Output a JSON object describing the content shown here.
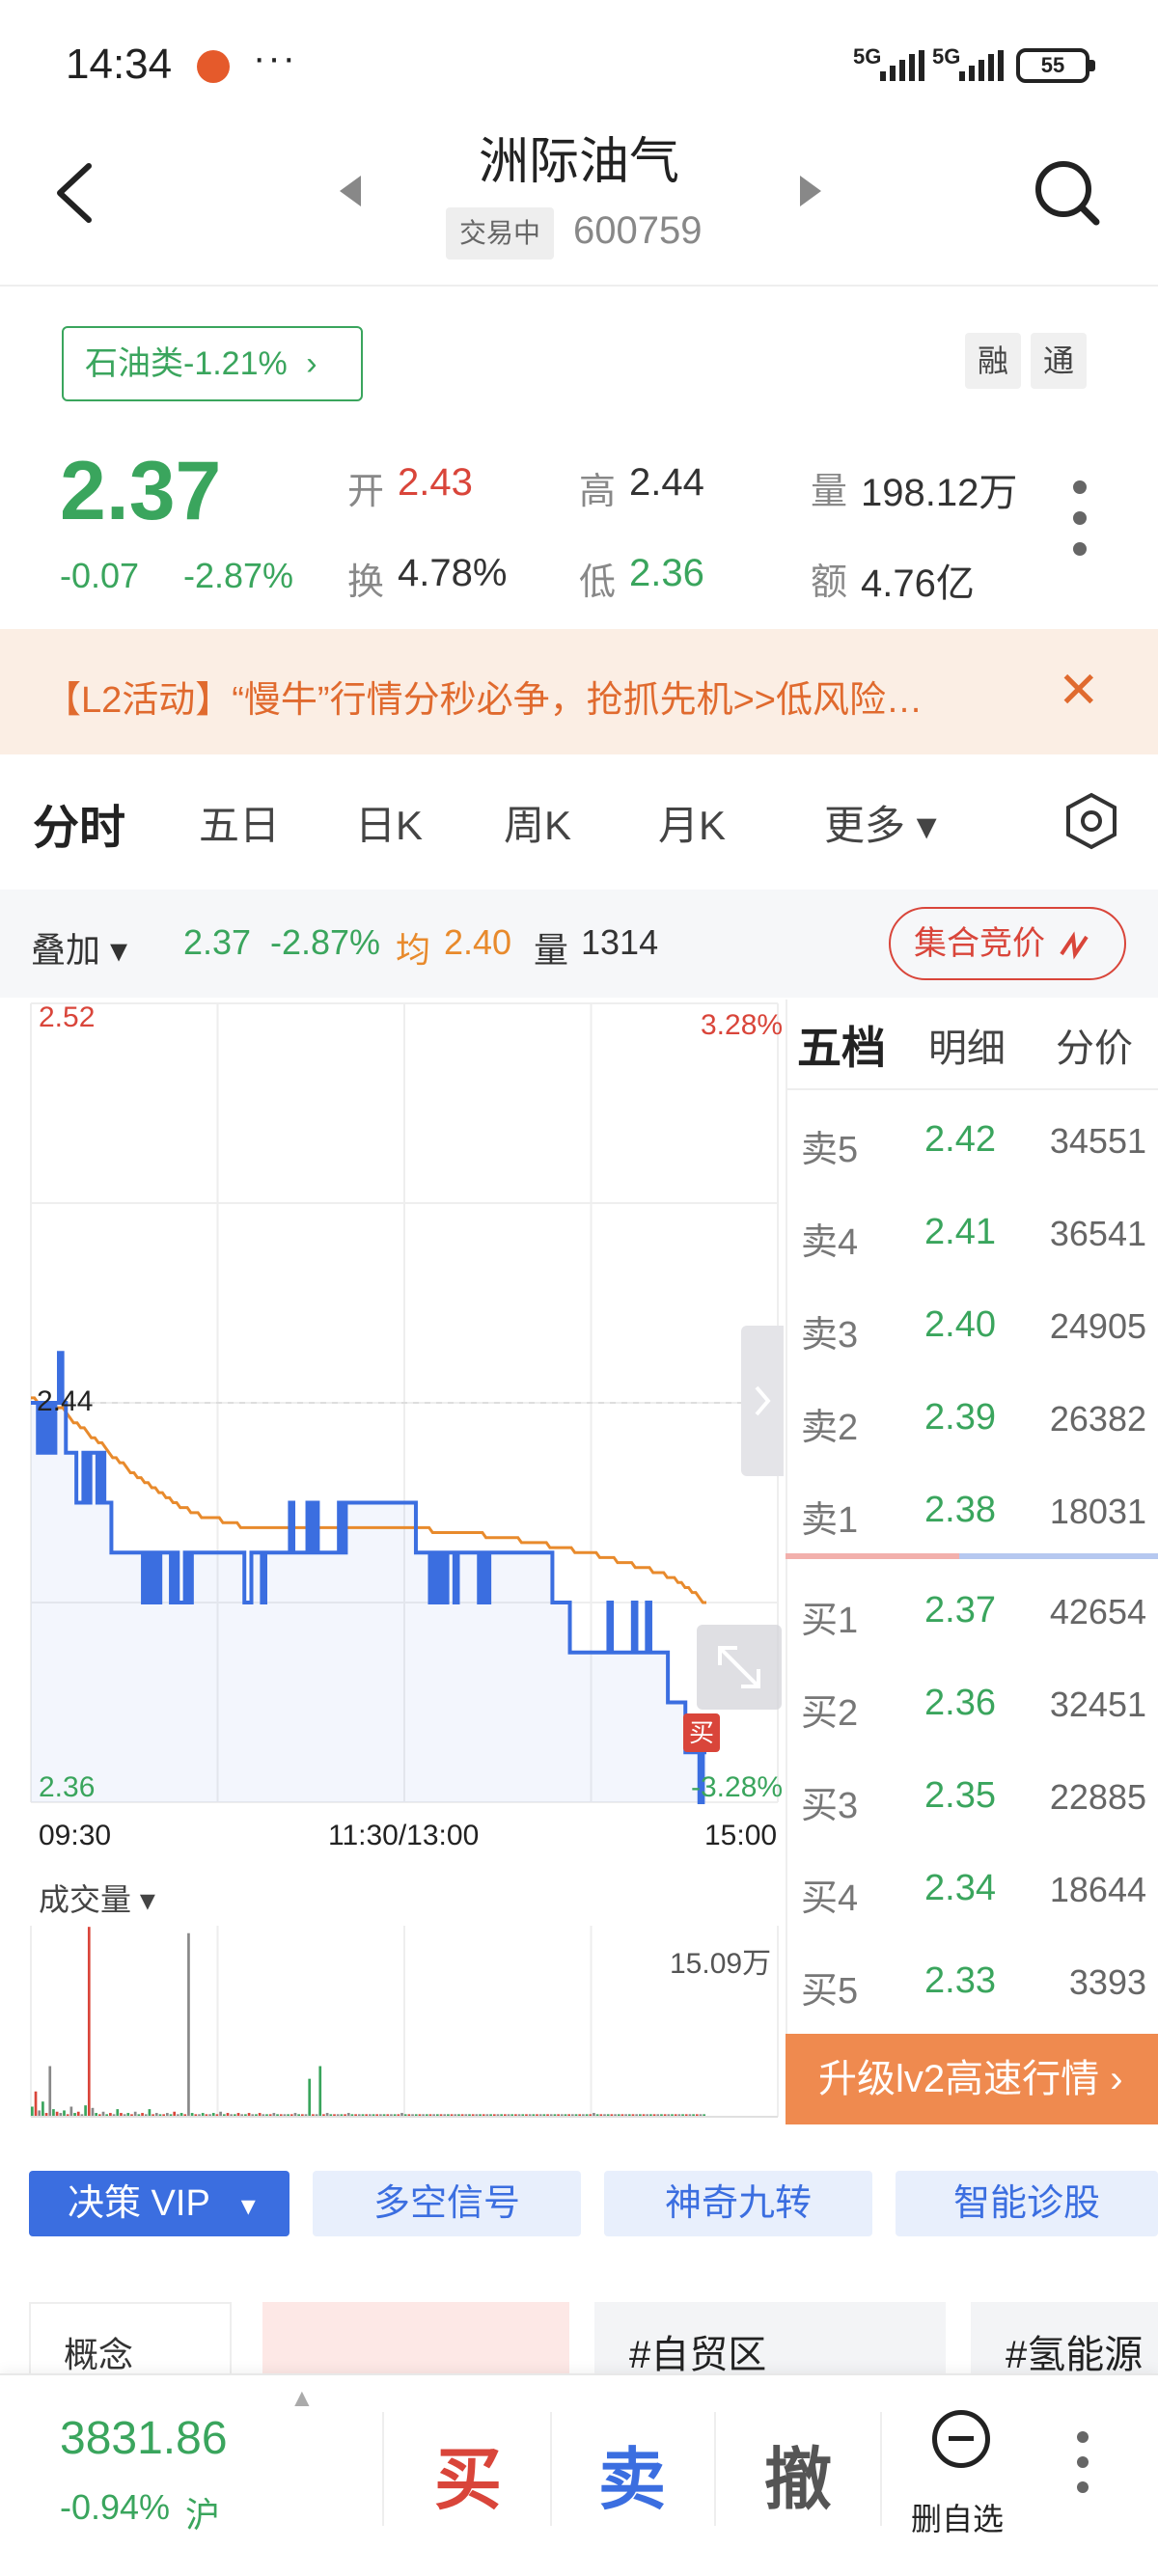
{
  "status_bar": {
    "time": "14:34",
    "dots": "···",
    "signal_a": "5G",
    "signal_b": "5G",
    "battery": "55"
  },
  "header": {
    "stock_name": "洲际油气",
    "trade_status": "交易中",
    "stock_code": "600759"
  },
  "sector": {
    "label": "石油类-1.21%",
    "chevron": "›"
  },
  "tags": {
    "margin": "融",
    "connect": "通"
  },
  "quote": {
    "price": "2.37",
    "change_abs": "-0.07",
    "change_pct": "-2.87%",
    "open_label": "开",
    "open": "2.43",
    "high_label": "高",
    "high": "2.44",
    "volume_label": "量",
    "volume": "198.12万",
    "turnover_label": "换",
    "turnover": "4.78%",
    "low_label": "低",
    "low": "2.36",
    "amount_label": "额",
    "amount": "4.76亿"
  },
  "banner": {
    "text": "【L2活动】“慢牛”行情分秒必争，抢抓先机>>低风险…",
    "close": "✕"
  },
  "tabs": [
    {
      "label": "分时"
    },
    {
      "label": "五日"
    },
    {
      "label": "日K"
    },
    {
      "label": "周K"
    },
    {
      "label": "月K"
    },
    {
      "label": "更多 ▾"
    }
  ],
  "overlay": {
    "toggle": "叠加 ▾",
    "price": "2.37",
    "pct": "-2.87%",
    "avg_label": "均",
    "avg": "2.40",
    "vol_label": "量",
    "vol": "1314",
    "auction": "集合竞价"
  },
  "chart_axes": {
    "high": "2.52",
    "high_pct": "3.28%",
    "prev_close": "2.44",
    "low": "2.36",
    "low_pct": "-3.28%",
    "t_open": "09:30",
    "t_mid": "11:30/13:00",
    "t_close": "15:00",
    "volume_label": "成交量 ▾",
    "volume_max": "15.09万",
    "buy_marker": "买"
  },
  "chart_data": {
    "type": "line",
    "ylim": [
      2.36,
      2.52
    ],
    "prev_close": 2.44,
    "x_labels": [
      "09:30",
      "11:30/13:00",
      "15:00"
    ],
    "series": [
      {
        "color": "#3b6ee0",
        "values": [
          2.44,
          2.44,
          2.43,
          2.44,
          2.43,
          2.44,
          2.43,
          2.44,
          2.45,
          2.44,
          2.43,
          2.43,
          2.43,
          2.42,
          2.42,
          2.43,
          2.42,
          2.43,
          2.43,
          2.42,
          2.43,
          2.42,
          2.42,
          2.41,
          2.41,
          2.41,
          2.41,
          2.41,
          2.41,
          2.41,
          2.41,
          2.41,
          2.4,
          2.41,
          2.4,
          2.41,
          2.4,
          2.41,
          2.41,
          2.41,
          2.4,
          2.41,
          2.4,
          2.4,
          2.41,
          2.4,
          2.41,
          2.41,
          2.41,
          2.41,
          2.41,
          2.41,
          2.41,
          2.41,
          2.41,
          2.41,
          2.41,
          2.41,
          2.41,
          2.41,
          2.41,
          2.4,
          2.4,
          2.41,
          2.41,
          2.41,
          2.4,
          2.41,
          2.41,
          2.41,
          2.41,
          2.41,
          2.41,
          2.41,
          2.42,
          2.41,
          2.41,
          2.41,
          2.41,
          2.42,
          2.41,
          2.42,
          2.41,
          2.41,
          2.41,
          2.41,
          2.41,
          2.41,
          2.42,
          2.41,
          2.42,
          2.42,
          2.42,
          2.42,
          2.42,
          2.42,
          2.42,
          2.42,
          2.42,
          2.42,
          2.42,
          2.42,
          2.42,
          2.42,
          2.42,
          2.42,
          2.42,
          2.42,
          2.42,
          2.42,
          2.41,
          2.41,
          2.41,
          2.41,
          2.4,
          2.41,
          2.4,
          2.41,
          2.4,
          2.41,
          2.41,
          2.4,
          2.41,
          2.41,
          2.41,
          2.41,
          2.41,
          2.41,
          2.4,
          2.41,
          2.4,
          2.41,
          2.41,
          2.41,
          2.41,
          2.41,
          2.41,
          2.41,
          2.41,
          2.41,
          2.41,
          2.41,
          2.41,
          2.41,
          2.41,
          2.41,
          2.41,
          2.41,
          2.41,
          2.4,
          2.4,
          2.4,
          2.4,
          2.4,
          2.39,
          2.39,
          2.39,
          2.39,
          2.39,
          2.39,
          2.39,
          2.39,
          2.39,
          2.39,
          2.39,
          2.4,
          2.39,
          2.39,
          2.39,
          2.39,
          2.39,
          2.39,
          2.4,
          2.39,
          2.39,
          2.39,
          2.4,
          2.39,
          2.39,
          2.39,
          2.39,
          2.39,
          2.38,
          2.38,
          2.38,
          2.38,
          2.38,
          2.37,
          2.37,
          2.37,
          2.37,
          2.36,
          2.37,
          2.37
        ]
      },
      {
        "color": "#e88a2c",
        "values": [
          2.441,
          2.441,
          2.44,
          2.44,
          2.44,
          2.439,
          2.439,
          2.439,
          2.439,
          2.439,
          2.438,
          2.437,
          2.436,
          2.436,
          2.435,
          2.435,
          2.434,
          2.433,
          2.433,
          2.432,
          2.432,
          2.431,
          2.43,
          2.429,
          2.429,
          2.428,
          2.428,
          2.427,
          2.426,
          2.426,
          2.425,
          2.425,
          2.424,
          2.424,
          2.423,
          2.423,
          2.422,
          2.422,
          2.421,
          2.421,
          2.42,
          2.42,
          2.419,
          2.419,
          2.419,
          2.418,
          2.418,
          2.418,
          2.417,
          2.417,
          2.417,
          2.417,
          2.417,
          2.417,
          2.416,
          2.416,
          2.416,
          2.416,
          2.416,
          2.415,
          2.415,
          2.415,
          2.415,
          2.415,
          2.415,
          2.415,
          2.415,
          2.415,
          2.415,
          2.415,
          2.415,
          2.415,
          2.415,
          2.415,
          2.415,
          2.415,
          2.415,
          2.415,
          2.415,
          2.415,
          2.415,
          2.415,
          2.415,
          2.415,
          2.415,
          2.415,
          2.415,
          2.415,
          2.415,
          2.415,
          2.415,
          2.415,
          2.415,
          2.415,
          2.415,
          2.415,
          2.415,
          2.415,
          2.415,
          2.415,
          2.415,
          2.415,
          2.415,
          2.415,
          2.415,
          2.415,
          2.415,
          2.415,
          2.415,
          2.415,
          2.415,
          2.415,
          2.415,
          2.414,
          2.414,
          2.414,
          2.414,
          2.414,
          2.414,
          2.414,
          2.414,
          2.414,
          2.414,
          2.414,
          2.414,
          2.414,
          2.414,
          2.414,
          2.413,
          2.413,
          2.413,
          2.413,
          2.413,
          2.413,
          2.413,
          2.413,
          2.413,
          2.413,
          2.412,
          2.412,
          2.412,
          2.412,
          2.412,
          2.412,
          2.412,
          2.412,
          2.411,
          2.411,
          2.411,
          2.411,
          2.411,
          2.411,
          2.411,
          2.41,
          2.41,
          2.41,
          2.41,
          2.41,
          2.41,
          2.41,
          2.409,
          2.409,
          2.409,
          2.409,
          2.409,
          2.408,
          2.408,
          2.408,
          2.408,
          2.408,
          2.407,
          2.407,
          2.407,
          2.407,
          2.407,
          2.406,
          2.406,
          2.406,
          2.406,
          2.405,
          2.405,
          2.405,
          2.404,
          2.404,
          2.403,
          2.403,
          2.402,
          2.402,
          2.401,
          2.4,
          2.4
        ]
      }
    ],
    "volume": {
      "ymax": 150900,
      "values": [
        8000,
        20000,
        5000,
        12000,
        3000,
        40000,
        6000,
        4000,
        3000,
        5000,
        2000,
        8000,
        3000,
        4000,
        2000,
        9000,
        150000,
        7000,
        3000,
        2000,
        4000,
        2000,
        3000,
        2000,
        6000,
        3000,
        2000,
        3000,
        2000,
        4000,
        2000,
        3000,
        2000,
        6000,
        2000,
        3000,
        2000,
        2000,
        3000,
        2000,
        4000,
        2000,
        3000,
        2000,
        145000,
        3000,
        2000,
        2000,
        3000,
        2000,
        2000,
        3000,
        2000,
        4000,
        2000,
        3000,
        2000,
        2000,
        3000,
        2000,
        2000,
        3000,
        2000,
        2000,
        3000,
        2000,
        2000,
        2000,
        3000,
        2000,
        2000,
        2000,
        2000,
        2000,
        3000,
        2000,
        2000,
        2000,
        30000,
        2000,
        2000,
        40000,
        2000,
        3000,
        2000,
        2000,
        2000,
        2000,
        2000,
        3000,
        2000,
        2000,
        2000,
        2000,
        2000,
        2000,
        2000,
        2000,
        2000,
        2000,
        2000,
        2000,
        2000,
        2000,
        3000,
        2000,
        2000,
        2000,
        2000,
        2000,
        2000,
        2000,
        2000,
        2000,
        2000,
        2000,
        2000,
        2000,
        2000,
        2000,
        2000,
        2000,
        2000,
        2000,
        2000,
        2000,
        2000,
        2000,
        2000,
        2000,
        2000,
        2000,
        2000,
        2000,
        2000,
        2000,
        2000,
        2000,
        2000,
        2000,
        2000,
        2000,
        2000,
        2000,
        2000,
        2000,
        2000,
        2000,
        2000,
        2000,
        2000,
        2000,
        2000,
        2000,
        2000,
        2000,
        2000,
        2000,
        3000,
        2000,
        2000,
        2000,
        2000,
        2000,
        2000,
        2000,
        2000,
        2000,
        2000,
        2000,
        2000,
        2000,
        2000,
        2000,
        2000,
        2000,
        2000,
        2000,
        2000,
        2000,
        2000,
        2000,
        2000,
        2000,
        2000,
        2000,
        2000,
        2000,
        2000,
        2000
      ]
    }
  },
  "order_book": {
    "tabs": [
      {
        "label": "五档"
      },
      {
        "label": "明细"
      },
      {
        "label": "分价"
      }
    ],
    "asks": [
      {
        "label": "卖5",
        "price": "2.42",
        "vol": "34551"
      },
      {
        "label": "卖4",
        "price": "2.41",
        "vol": "36541"
      },
      {
        "label": "卖3",
        "price": "2.40",
        "vol": "24905"
      },
      {
        "label": "卖2",
        "price": "2.39",
        "vol": "26382"
      },
      {
        "label": "卖1",
        "price": "2.38",
        "vol": "18031"
      }
    ],
    "bids": [
      {
        "label": "买1",
        "price": "2.37",
        "vol": "42654"
      },
      {
        "label": "买2",
        "price": "2.36",
        "vol": "32451"
      },
      {
        "label": "买3",
        "price": "2.35",
        "vol": "22885"
      },
      {
        "label": "买4",
        "price": "2.34",
        "vol": "18644"
      },
      {
        "label": "买5",
        "price": "2.33",
        "vol": "3393"
      }
    ],
    "upgrade": "升级lv2高速行情 ›"
  },
  "indicators": {
    "vip": "决策 VIP",
    "vip_arrow": "▾",
    "signal": "多空信号",
    "nine": "神奇九转",
    "diagnose": "智能诊股"
  },
  "concepts": {
    "label": "概念",
    "tag1": "#自贸区",
    "tag2": "#氢能源"
  },
  "bottom": {
    "index_value": "3831.86",
    "index_change": "-0.94%",
    "index_market": "沪",
    "buy": "买",
    "sell": "卖",
    "cancel": "撤",
    "remove_fav": "删自选"
  },
  "colors": {
    "up": "#d9453a",
    "down": "#3aa55d",
    "accent": "#3b6ee0",
    "avg": "#e88a2c"
  }
}
